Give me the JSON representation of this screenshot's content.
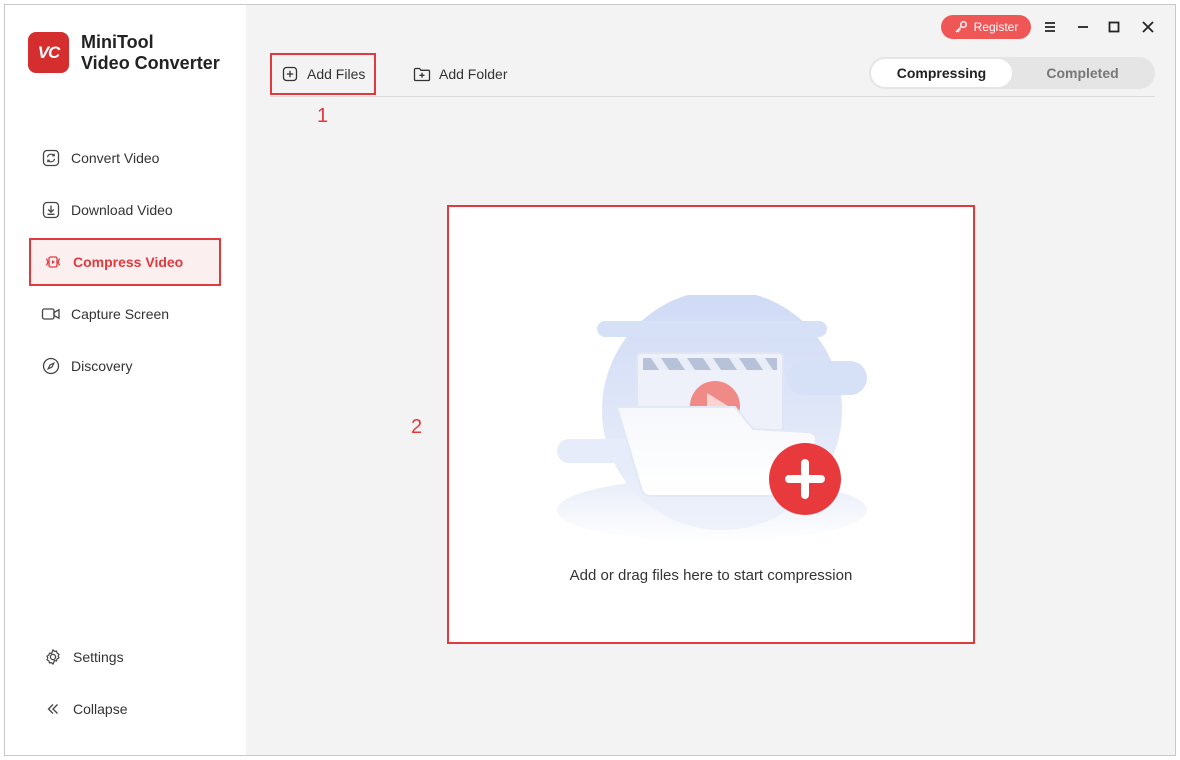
{
  "app": {
    "logo_text": "VC",
    "brand_line1": "MiniTool",
    "brand_line2": "Video Converter"
  },
  "sidebar": {
    "items": [
      {
        "label": "Convert Video",
        "icon": "convert-icon",
        "active": false
      },
      {
        "label": "Download Video",
        "icon": "download-icon",
        "active": false
      },
      {
        "label": "Compress Video",
        "icon": "compress-icon",
        "active": true
      },
      {
        "label": "Capture Screen",
        "icon": "camera-icon",
        "active": false
      },
      {
        "label": "Discovery",
        "icon": "compass-icon",
        "active": false
      }
    ],
    "settings_label": "Settings",
    "collapse_label": "Collapse"
  },
  "titlebar": {
    "register_label": "Register",
    "menu_icon": "hamburger-icon",
    "minimize_icon": "minimize-icon",
    "maximize_icon": "maximize-icon",
    "close_icon": "close-icon"
  },
  "toolbar": {
    "add_files_label": "Add Files",
    "add_folder_label": "Add Folder"
  },
  "tabs": {
    "compressing": "Compressing",
    "completed": "Completed",
    "active": "Compressing"
  },
  "annotations": {
    "step1": "1",
    "step2": "2"
  },
  "dropzone": {
    "text": "Add or drag files here to start compression"
  },
  "colors": {
    "accent": "#e0393e",
    "register_bg": "#ef5656",
    "sidebar_bg": "#ffffff",
    "content_bg": "#f3f3f3"
  }
}
